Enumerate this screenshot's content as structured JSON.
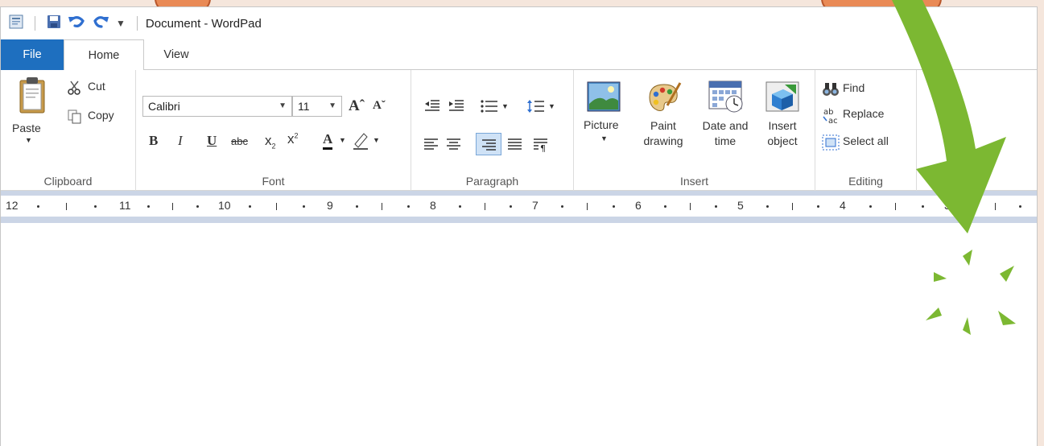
{
  "window": {
    "title": "Document - WordPad"
  },
  "tabs": [
    {
      "label": "File"
    },
    {
      "label": "Home"
    },
    {
      "label": "View"
    }
  ],
  "ribbon": {
    "clipboard": {
      "paste": "Paste",
      "cut": "Cut",
      "copy": "Copy",
      "group": "Clipboard"
    },
    "font": {
      "family": "Calibri",
      "size": "11",
      "group": "Font"
    },
    "paragraph": {
      "group": "Paragraph"
    },
    "insert": {
      "picture": "Picture",
      "paint_1": "Paint",
      "paint_2": "drawing",
      "datetime_1": "Date and",
      "datetime_2": "time",
      "object_1": "Insert",
      "object_2": "object",
      "group": "Insert"
    },
    "editing": {
      "find": "Find",
      "replace": "Replace",
      "select_all": "Select all",
      "group": "Editing"
    }
  },
  "ruler": {
    "numbers": [
      "12",
      "11",
      "10",
      "9",
      "8",
      "7",
      "6",
      "5",
      "4",
      "3"
    ]
  },
  "colors": {
    "file_tab": "#1e6fbf",
    "arrow": "#7cb832",
    "ruler_band": "#cbd5e6"
  }
}
